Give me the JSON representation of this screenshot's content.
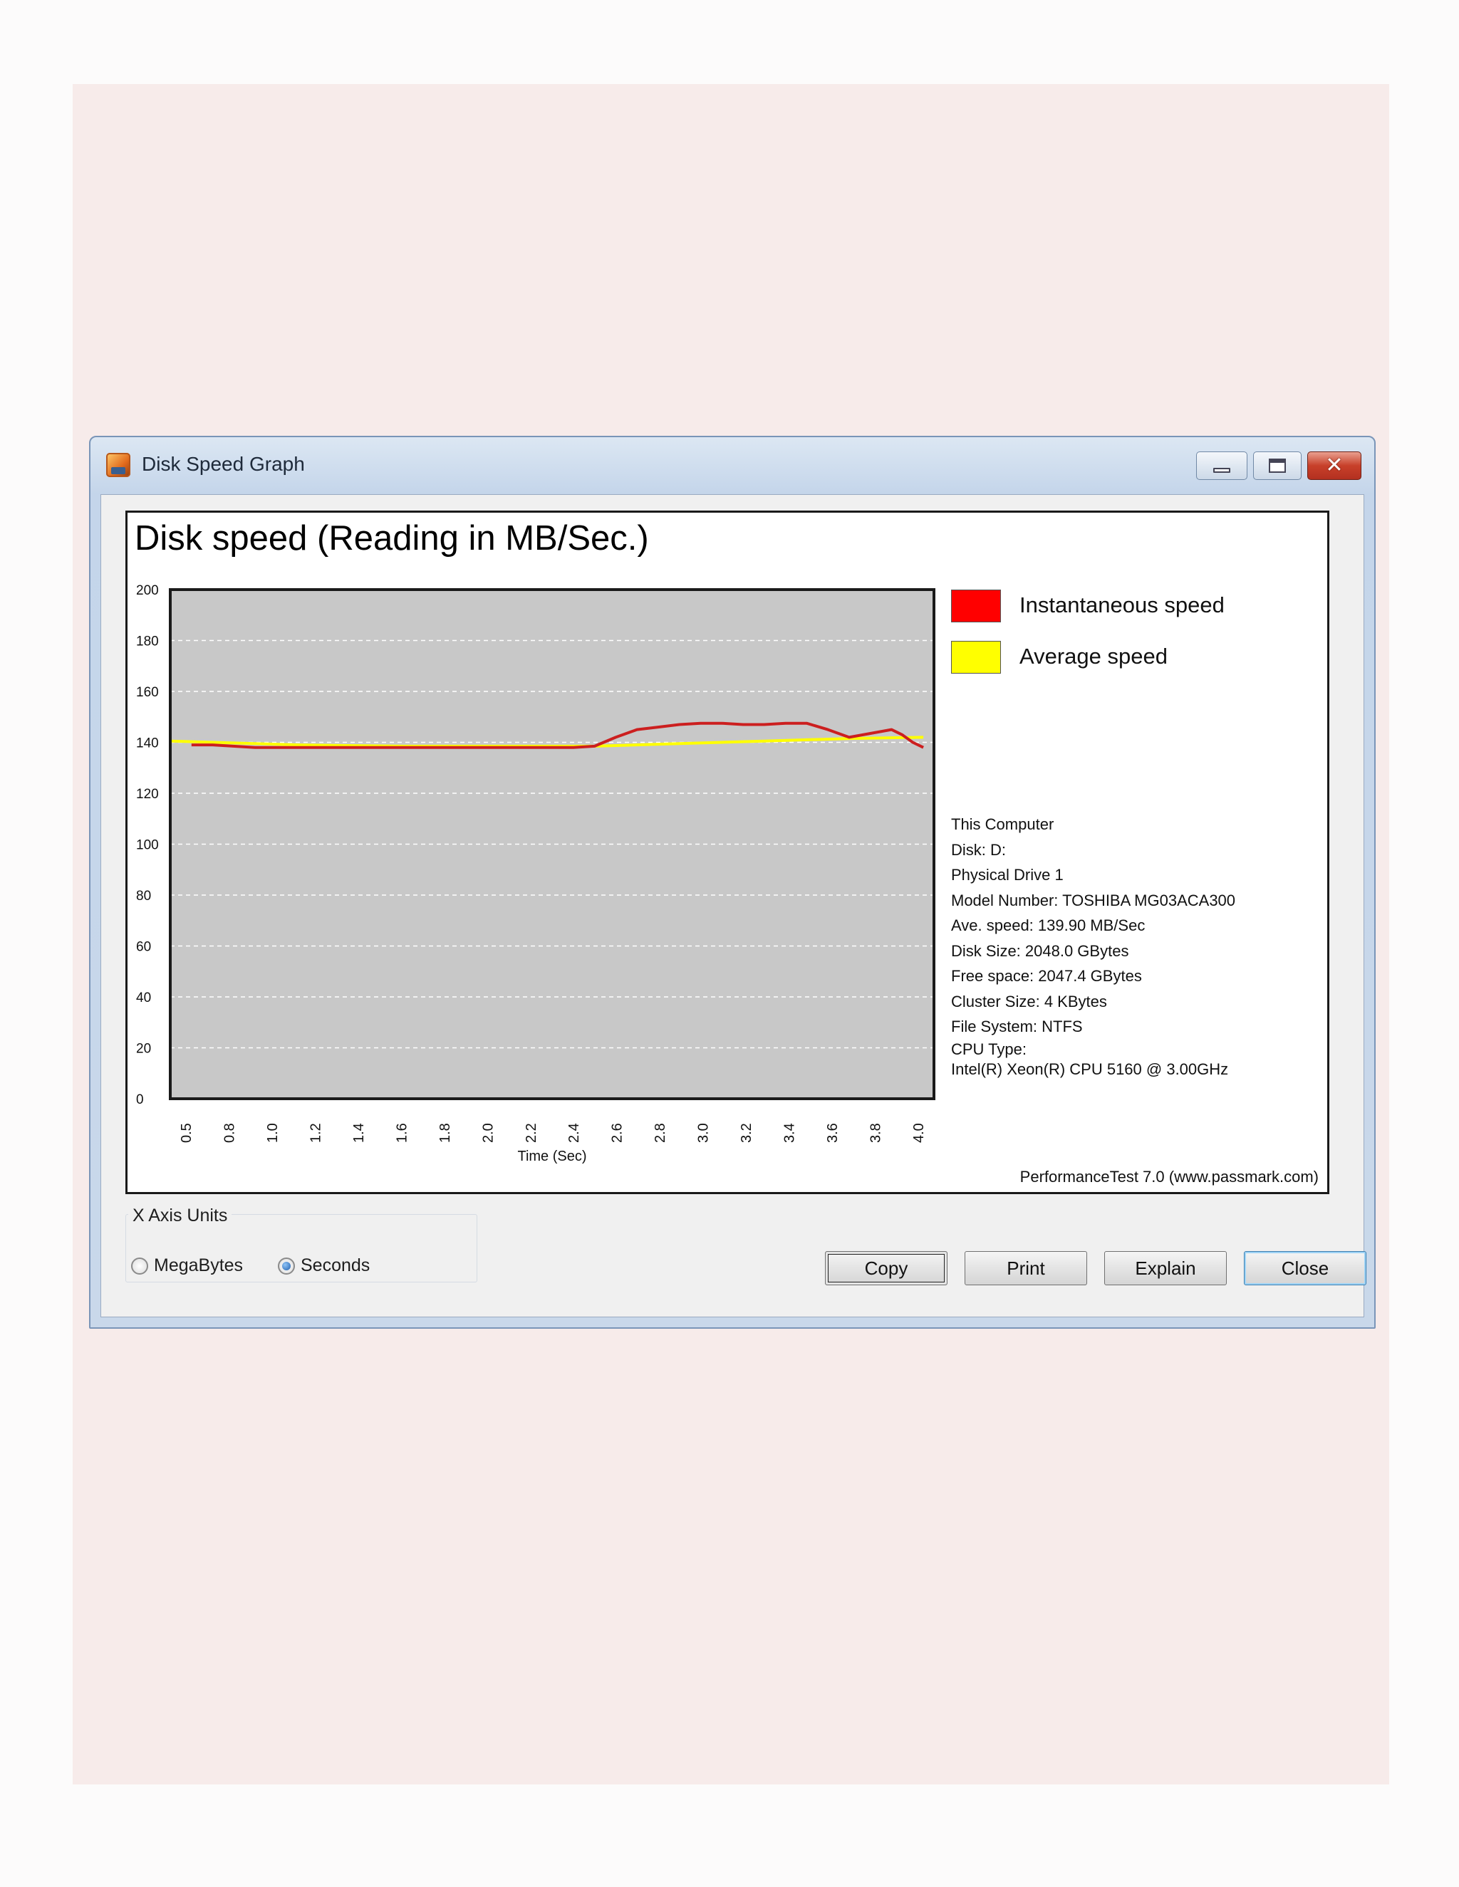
{
  "window": {
    "title": "Disk Speed Graph"
  },
  "chart": {
    "title": "Disk speed (Reading in MB/Sec.)",
    "credit": "PerformanceTest 7.0 (www.passmark.com)",
    "legend": [
      {
        "label": "Instantaneous speed",
        "color": "#ff0000"
      },
      {
        "label": "Average speed",
        "color": "#ffff00"
      }
    ],
    "info_lines": [
      "This Computer",
      "Disk: D:",
      "Physical Drive 1",
      "Model Number: TOSHIBA MG03ACA300",
      "Ave. speed: 139.90 MB/Sec",
      "Disk Size: 2048.0 GBytes",
      "Free space: 2047.4 GBytes",
      "Cluster Size: 4 KBytes",
      "File System: NTFS",
      "CPU Type:",
      "Intel(R) Xeon(R) CPU 5160 @ 3.00GHz"
    ]
  },
  "chart_data": {
    "type": "line",
    "title": "Disk speed (Reading in MB/Sec.)",
    "xlabel": "Time (Sec)",
    "ylabel": "",
    "ylim": [
      0,
      200
    ],
    "yticks": [
      "0",
      "20",
      "40",
      "60",
      "80",
      "100",
      "120",
      "140",
      "160",
      "180",
      "200"
    ],
    "xlim": [
      0.4,
      4.0
    ],
    "xticks": [
      "0.5",
      "0.8",
      "1.0",
      "1.2",
      "1.4",
      "1.6",
      "1.8",
      "2.0",
      "2.2",
      "2.4",
      "2.6",
      "2.8",
      "3.0",
      "3.2",
      "3.4",
      "3.6",
      "3.8",
      "4.0"
    ],
    "grid": true,
    "legend_position": "right",
    "series": [
      {
        "name": "Instantaneous speed",
        "color": "#cc1f1f",
        "x": [
          0.5,
          0.6,
          0.8,
          1.0,
          1.5,
          2.0,
          2.3,
          2.4,
          2.5,
          2.6,
          2.7,
          2.8,
          2.9,
          3.0,
          3.1,
          3.2,
          3.3,
          3.4,
          3.5,
          3.6,
          3.7,
          3.8,
          3.85,
          3.9,
          3.95
        ],
        "y": [
          139,
          139,
          138,
          138,
          138,
          138,
          138,
          138.5,
          142,
          145,
          146,
          147,
          147.5,
          147.5,
          147,
          147,
          147.5,
          147.5,
          145,
          142,
          143.5,
          145,
          143,
          140,
          138
        ]
      },
      {
        "name": "Average speed",
        "color": "#ffff00",
        "x": [
          0.4,
          1.0,
          1.5,
          2.0,
          2.4,
          2.8,
          3.2,
          3.6,
          3.95
        ],
        "y": [
          140.5,
          139,
          138.5,
          138.5,
          138.5,
          139.5,
          140.5,
          141.5,
          142
        ]
      }
    ]
  },
  "x_axis_units": {
    "group_label": "X Axis Units",
    "options": [
      {
        "label": "MegaBytes",
        "selected": false
      },
      {
        "label": "Seconds",
        "selected": true
      }
    ]
  },
  "buttons": {
    "copy": "Copy",
    "print": "Print",
    "explain": "Explain",
    "close": "Close"
  }
}
